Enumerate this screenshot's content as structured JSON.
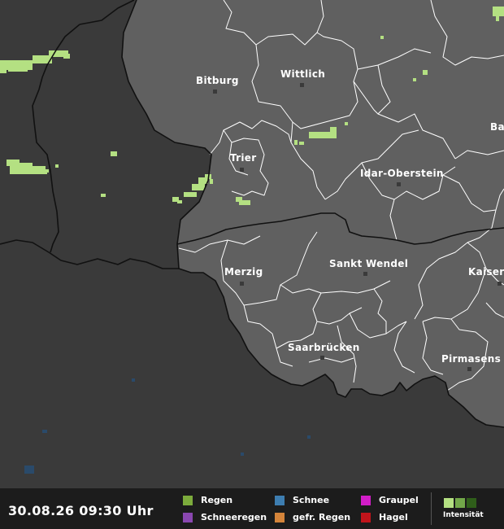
{
  "timestamp": "30.08.26 09:30 Uhr",
  "legend": [
    {
      "label": "Regen",
      "color": "#7cab3c"
    },
    {
      "label": "Schneeregen",
      "color": "#8a47b0"
    },
    {
      "label": "Schnee",
      "color": "#3d7db0"
    },
    {
      "label": "gefr. Regen",
      "color": "#d4843a"
    },
    {
      "label": "Graupel",
      "color": "#d21dc8"
    },
    {
      "label": "Hagel",
      "color": "#c0141b"
    }
  ],
  "intensity": {
    "label": "Intensität",
    "colors": [
      "#b4e082",
      "#73a84a",
      "#2f5e1a"
    ]
  },
  "cities": [
    {
      "name": "Bitburg"
    },
    {
      "name": "Wittlich"
    },
    {
      "name": "Trier"
    },
    {
      "name": "Idar-Oberstein"
    },
    {
      "name": "Ba"
    },
    {
      "name": "Merzig"
    },
    {
      "name": "Sankt Wendel"
    },
    {
      "name": "Kaiser"
    },
    {
      "name": "Saarbrücken"
    },
    {
      "name": "Pirmasens"
    }
  ],
  "colors": {
    "land_germany": "#606060",
    "land_outside": "#3a3a3a",
    "rain": "#b4e082"
  }
}
